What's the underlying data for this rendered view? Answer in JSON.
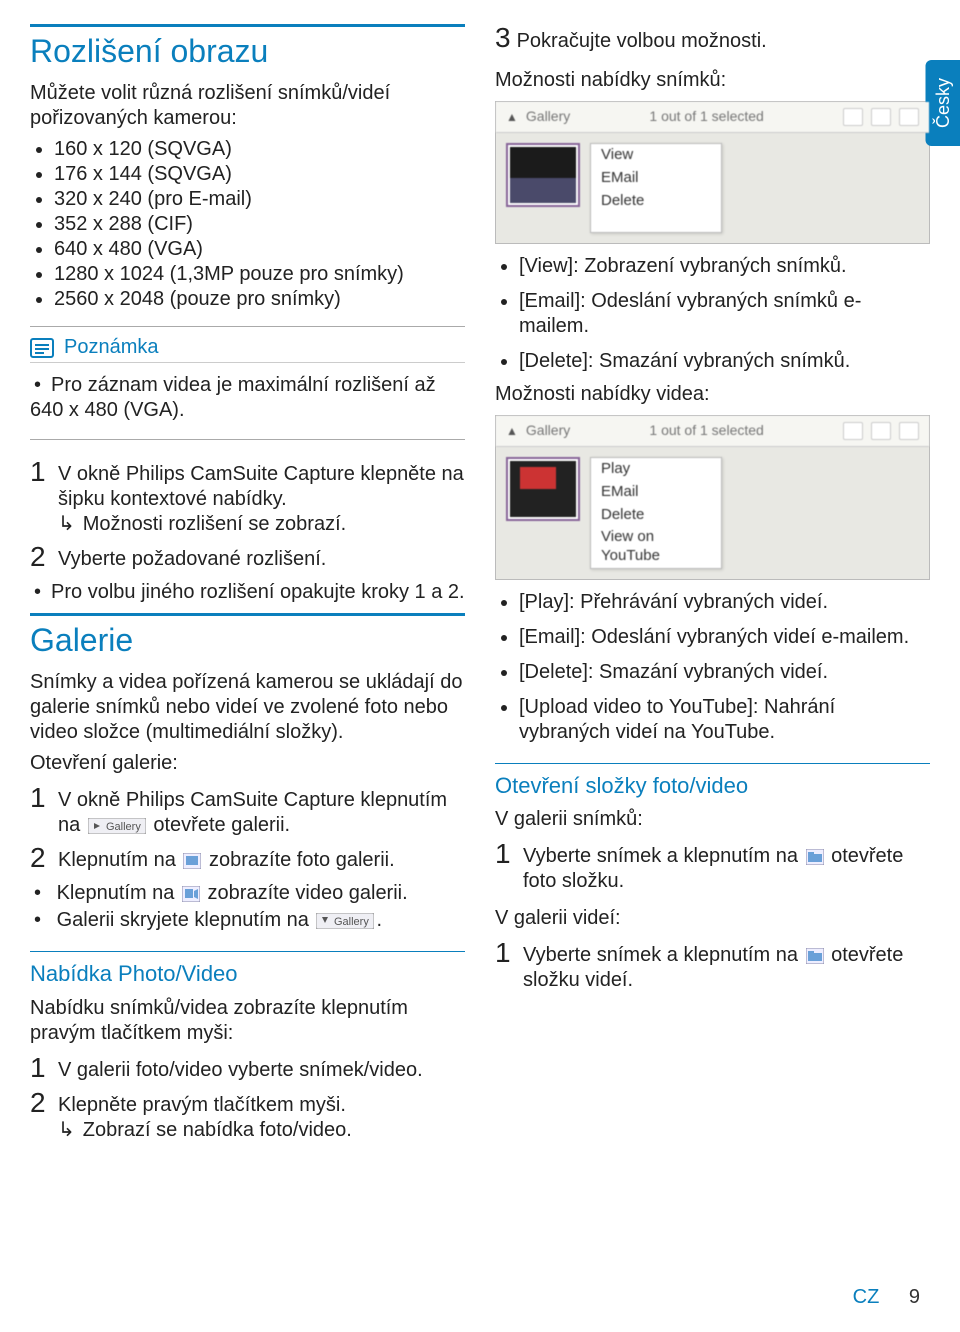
{
  "language_tab": "Česky",
  "header1": "Rozlišení obrazu",
  "intro1": "Můžete volit různá rozlišení snímků/videí pořizovaných kamerou:",
  "resolutions": [
    "160 x 120 (SQVGA)",
    "176 x 144 (SQVGA)",
    "320 x 240 (pro E-mail)",
    "352 x 288 (CIF)",
    "640 x 480 (VGA)",
    "1280 x 1024 (1,3MP pouze pro snímky)",
    "2560 x 2048 (pouze pro snímky)"
  ],
  "note": {
    "label": "Poznámka",
    "body": "Pro záznam videa je maximální rozlišení až 640 x 480 (VGA)."
  },
  "steps_res": [
    {
      "n": "1",
      "text": "V okně Philips CamSuite Capture klepněte na šipku kontextové nabídky.",
      "arrow": "Možnosti rozlišení se zobrazí."
    },
    {
      "n": "2",
      "text": "Vyberte požadované rozlišení."
    }
  ],
  "res_sub_bullet": "Pro volbu jiného rozlišení opakujte kroky 1 a 2.",
  "header2": "Galerie",
  "galerie_intro": "Snímky a videa pořízená kamerou se ukládají do galerie snímků nebo videí ve zvolené foto nebo video složce (multimediální složky).",
  "galerie_open": "Otevření galerie:",
  "galerie_steps": [
    {
      "n": "1",
      "pre": "V okně Philips CamSuite Capture klepnutím na ",
      "post": " otevřete galerii."
    },
    {
      "n": "2",
      "pre": "Klepnutím na ",
      "post": " zobrazíte foto galerii."
    }
  ],
  "galerie_bullets": [
    {
      "pre": "Klepnutím na ",
      "post": " zobrazíte video galerii."
    },
    {
      "pre": "Galerii skryjete klepnutím na ",
      "post": "."
    }
  ],
  "nabidka_head": "Nabídka Photo/Video",
  "nabidka_intro": "Nabídku snímků/videa zobrazíte klepnutím pravým tlačítkem myši:",
  "nabidka_steps": [
    {
      "n": "1",
      "text": "V galerii foto/video vyberte snímek/video."
    },
    {
      "n": "2",
      "text": "Klepněte pravým tlačítkem myši.",
      "arrow": "Zobrazí se nabídka foto/video."
    }
  ],
  "right_top": "Pokračujte volbou možnosti.",
  "snimku_head": "Možnosti nabídky snímků:",
  "gallery_label": "Gallery",
  "count_label": "1 out of 1 selected",
  "ctx_photo": [
    "View",
    "EMail",
    "Delete"
  ],
  "snimku_bullets": [
    "[View]: Zobrazení vybraných snímků.",
    "[Email]: Odeslání vybraných snímků e-mailem.",
    "[Delete]: Smazání vybraných snímků."
  ],
  "videa_head": "Možnosti nabídky videa:",
  "ctx_video": [
    "Play",
    "EMail",
    "Delete",
    "View on YouTube"
  ],
  "videa_bullets": [
    "[Play]: Přehrávání vybraných videí.",
    "[Email]: Odeslání vybraných videí e-mailem.",
    "[Delete]: Smazání vybraných videí.",
    "[Upload video to YouTube]: Nahrání vybraných videí na YouTube."
  ],
  "folder_head": "Otevření složky foto/video",
  "folder_snimku": "V galerii snímků:",
  "folder_snimku_step": {
    "n": "1",
    "pre": "Vyberte snímek a klepnutím na ",
    "post": " otevřete foto složku."
  },
  "folder_videi": "V galerii videí:",
  "folder_videi_step": {
    "n": "1",
    "pre": "Vyberte snímek a klepnutím na ",
    "post": " otevřete složku videí."
  },
  "footer_region": "CZ",
  "footer_page": "9"
}
